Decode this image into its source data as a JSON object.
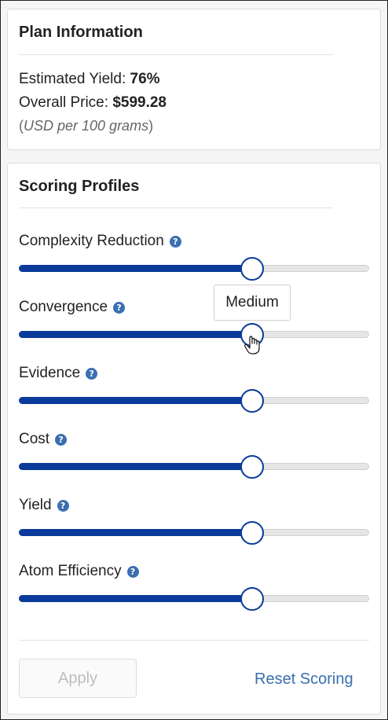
{
  "plan": {
    "title": "Plan Information",
    "yield_label": "Estimated Yield:",
    "yield_value": "76%",
    "price_label": "Overall Price:",
    "price_value": "$599.28",
    "unit_note": "USD per 100 grams"
  },
  "scoring": {
    "title": "Scoring Profiles",
    "sliders": [
      {
        "label": "Complexity Reduction",
        "level": 0.667
      },
      {
        "label": "Convergence",
        "level": 0.667
      },
      {
        "label": "Evidence",
        "level": 0.667
      },
      {
        "label": "Cost",
        "level": 0.667
      },
      {
        "label": "Yield",
        "level": 0.667
      },
      {
        "label": "Atom Efficiency",
        "level": 0.667
      }
    ],
    "tooltip": "Medium",
    "help_icon": "?",
    "apply_label": "Apply",
    "reset_label": "Reset Scoring"
  },
  "colors": {
    "accent": "#0a3a9a",
    "link": "#3a6fb0"
  }
}
